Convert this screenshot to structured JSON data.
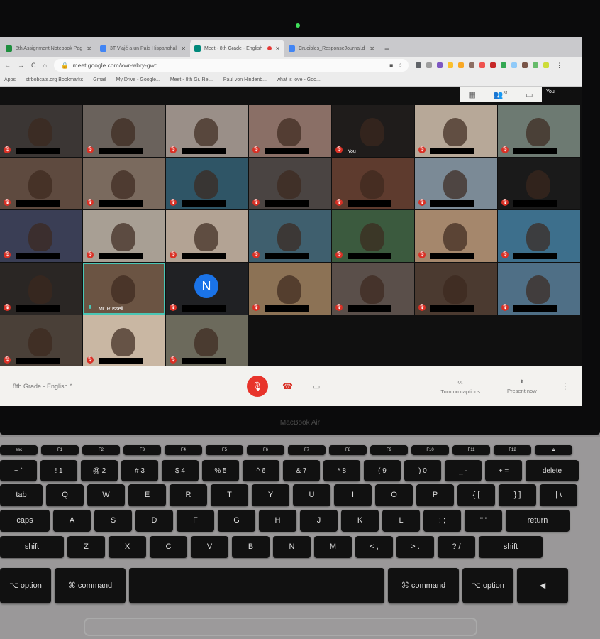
{
  "browser": {
    "tabs": [
      {
        "label": "8th Assignment Notebook Pag",
        "icon_color": "#1e8e3e"
      },
      {
        "label": "3T Viajé a un País Hispanohal",
        "icon_color": "#4285f4"
      },
      {
        "label": "Meet - 8th Grade - English",
        "icon_color": "#00897b",
        "active": true,
        "recording": true
      },
      {
        "label": "Crucibles_ResponseJournal.d",
        "icon_color": "#4285f4"
      }
    ],
    "url": "meet.google.com/xwr-wbry-gwd",
    "bookmarks": [
      "Apps",
      "strbobcats.org Bookmarks",
      "Gmail",
      "My Drive - Google...",
      "Meet - 8th Gr. Rel...",
      "Paul von Hindenb...",
      "what is love - Goo..."
    ],
    "extension_colors": [
      "#5f6368",
      "#9e9e9e",
      "#7e57c2",
      "#fbc02d",
      "#f9a825",
      "#8d6e63",
      "#ef5350",
      "#c62828",
      "#34a853",
      "#90caf9",
      "#795548",
      "#66bb6a",
      "#cddc39"
    ]
  },
  "meet": {
    "participant_count": "31",
    "self_label": "You",
    "meeting_name": "8th Grade - English",
    "captions_label": "Turn on captions",
    "present_label": "Present now",
    "tiles": [
      {
        "bg": "#3b3634"
      },
      {
        "bg": "#6a625c"
      },
      {
        "bg": "#9a8f88"
      },
      {
        "bg": "#8a6f66"
      },
      {
        "bg": "#1f1c1b",
        "name": "You"
      },
      {
        "bg": "#b7a898"
      },
      {
        "bg": "#6d7a72"
      },
      {
        "bg": "#5e4a3f"
      },
      {
        "bg": "#7a6a5e"
      },
      {
        "bg": "#2f5566"
      },
      {
        "bg": "#4a4442"
      },
      {
        "bg": "#5e3b2e"
      },
      {
        "bg": "#7b8a96"
      },
      {
        "bg": "#1a1a1a"
      },
      {
        "bg": "#3a3e55"
      },
      {
        "bg": "#a89f94"
      },
      {
        "bg": "#b3a394"
      },
      {
        "bg": "#3f5f6e"
      },
      {
        "bg": "#3b5a3e"
      },
      {
        "bg": "#a5876c"
      },
      {
        "bg": "#3d6f8c"
      },
      {
        "bg": "#2a2624"
      },
      {
        "bg": "#6b5443",
        "name": "Mr. Russell",
        "speaking": true
      },
      {
        "bg": "#202124",
        "avatar": "N"
      },
      {
        "bg": "#8c7255"
      },
      {
        "bg": "#5a4f4a"
      },
      {
        "bg": "#4b3a30"
      },
      {
        "bg": "#4f6f86"
      },
      {
        "bg": "#4a4038"
      },
      {
        "bg": "#c9b7a3"
      },
      {
        "bg": "#6c6a5c"
      }
    ]
  },
  "laptop": {
    "model": "MacBook Air"
  },
  "keyboard": {
    "fn": [
      "esc",
      "F1",
      "F2",
      "F3",
      "F4",
      "F5",
      "F6",
      "F7",
      "F8",
      "F9",
      "F10",
      "F11",
      "F12",
      "⏏"
    ],
    "num": [
      "~ `",
      "! 1",
      "@ 2",
      "# 3",
      "$ 4",
      "% 5",
      "^ 6",
      "& 7",
      "* 8",
      "( 9",
      ") 0",
      "_ -",
      "+ =",
      "delete"
    ],
    "qwerty": [
      "tab",
      "Q",
      "W",
      "E",
      "R",
      "T",
      "Y",
      "U",
      "I",
      "O",
      "P",
      "{ [",
      "} ]",
      "| \\"
    ],
    "asdf": [
      "caps",
      "A",
      "S",
      "D",
      "F",
      "G",
      "H",
      "J",
      "K",
      "L",
      ": ;",
      "\" '",
      "return"
    ],
    "zxcv": [
      "shift",
      "Z",
      "X",
      "C",
      "V",
      "B",
      "N",
      "M",
      "< ,",
      "> .",
      "? /",
      "shift"
    ],
    "bottom": [
      "⌥ option",
      "⌘ command",
      "",
      "⌘ command",
      "⌥ option",
      "◀"
    ]
  }
}
